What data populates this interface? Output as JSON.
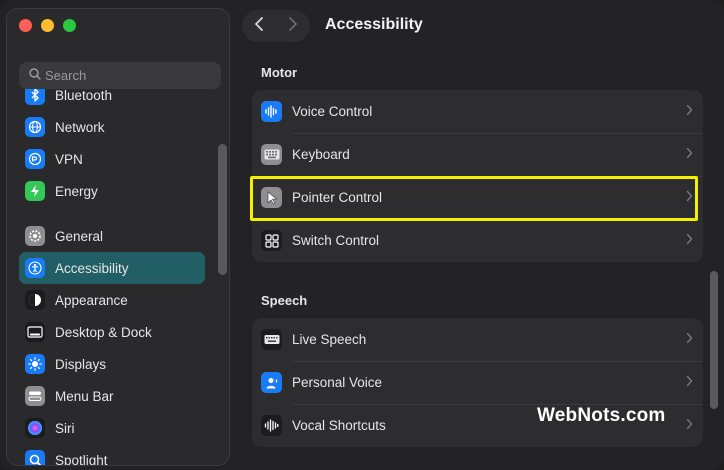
{
  "window": {
    "title": "Accessibility"
  },
  "sidebar": {
    "search_placeholder": "Search",
    "groups": [
      {
        "items": [
          {
            "label": "Bluetooth",
            "icon": "bluetooth-icon",
            "color": "#1a7cf5"
          },
          {
            "label": "Network",
            "icon": "globe-icon",
            "color": "#1a7cf5"
          },
          {
            "label": "VPN",
            "icon": "vpn-icon",
            "color": "#1a7cf5"
          },
          {
            "label": "Energy",
            "icon": "bolt-icon",
            "color": "#34c759"
          }
        ]
      },
      {
        "items": [
          {
            "label": "General",
            "icon": "gear-icon",
            "color": "#8e8e93"
          },
          {
            "label": "Accessibility",
            "icon": "accessibility-icon",
            "color": "#1a7cf5",
            "active": true
          },
          {
            "label": "Appearance",
            "icon": "appearance-icon",
            "color": "#1c1c1e"
          },
          {
            "label": "Desktop & Dock",
            "icon": "dock-icon",
            "color": "#1c1c1e"
          },
          {
            "label": "Displays",
            "icon": "sun-icon",
            "color": "#1a7cf5"
          },
          {
            "label": "Menu Bar",
            "icon": "menu-bar-icon",
            "color": "#8e8e93"
          },
          {
            "label": "Siri",
            "icon": "siri-icon",
            "color": "#5e3fbe"
          },
          {
            "label": "Spotlight",
            "icon": "spotlight-icon",
            "color": "#1a7cf5"
          }
        ]
      }
    ]
  },
  "main": {
    "sections": [
      {
        "title": "Motor",
        "rows": [
          {
            "label": "Voice Control",
            "icon": "voice-control-icon",
            "color": "#1a7cf5"
          },
          {
            "label": "Keyboard",
            "icon": "keyboard-icon",
            "color": "#8e8e93"
          },
          {
            "label": "Pointer Control",
            "icon": "pointer-icon",
            "color": "#8e8e93",
            "highlighted": true
          },
          {
            "label": "Switch Control",
            "icon": "switch-control-icon",
            "color": "#1c1c1e"
          }
        ]
      },
      {
        "title": "Speech",
        "rows": [
          {
            "label": "Live Speech",
            "icon": "live-speech-icon",
            "color": "#1c1c1e"
          },
          {
            "label": "Personal Voice",
            "icon": "personal-voice-icon",
            "color": "#1a7cf5"
          },
          {
            "label": "Vocal Shortcuts",
            "icon": "vocal-shortcuts-icon",
            "color": "#1c1c1e"
          }
        ]
      }
    ]
  },
  "highlight_color": "#f4f000",
  "accent_active": "#215e66",
  "watermark": "WebNots.com"
}
